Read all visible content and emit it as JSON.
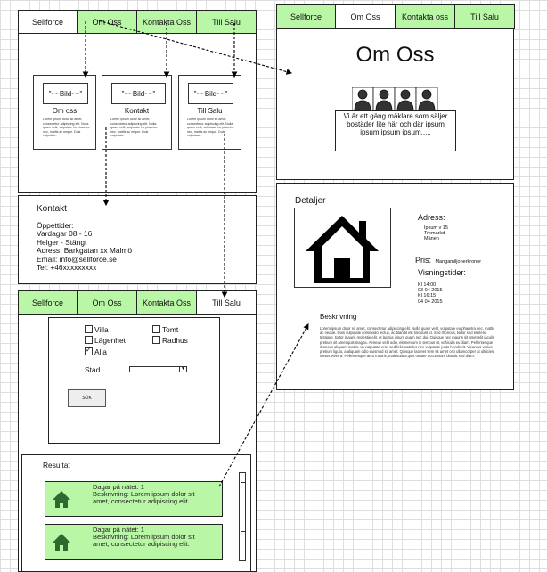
{
  "tabs": [
    "Sellforce",
    "Om Oss",
    "Kontakta Oss",
    "Till Salu"
  ],
  "tabs_lower": [
    "Sellforce",
    "Om Oss",
    "Kontakta Oss",
    "Till Salu"
  ],
  "right_tabs": [
    "Sellforce",
    "Om Oss",
    "Kontakta oss",
    "Till Salu"
  ],
  "home_cards": [
    {
      "image": "\"~~Bild~~\"",
      "title": "Om oss"
    },
    {
      "image": "\"~~Bild~~\"",
      "title": "Kontakt"
    },
    {
      "image": "\"~~Bild~~\"",
      "title": "Till Salu"
    }
  ],
  "card_lorem": "Lorem ipsum dolor sit amet, consectetur adipiscing elit. Nulla quam velit, vulputate eu pharetra nec, mattis ac neque. Duis vulputate.",
  "contact": {
    "heading": "Kontakt",
    "lines": [
      "Öppettider:",
      "Vardagar 08 - 16",
      "Helger - Stängt",
      "Adress: Barkgatan xx Malmö",
      "Email: info@sellforce.se",
      "Tel: +46xxxxxxxxx"
    ]
  },
  "about": {
    "title": "Om Oss",
    "text": "Vi är ett gäng mäklare som säljer bostäder lite här och där ipsum ipsum ipsum ipsum....."
  },
  "details": {
    "heading": "Detaljer",
    "address_label": "Adress:",
    "address_lines": [
      "Ipsum v 15",
      "Tremarkd",
      "Mänen"
    ],
    "price_label": "Pris:",
    "price_value": "Mangamiljonerkronor",
    "viewings_label": "Visningstider:",
    "viewings": [
      "Kl 14:00",
      "03 04 2015",
      "Kl 16:15",
      "04 04 2015"
    ],
    "desc_heading": "Beskrivning",
    "desc_text": "Lorem ipsum dolor sit amet, consectetur adipiscing elit. Nulla quam velit, vulputate eu pharetra nec, mattis ac neque. Duis vulputate commodo lectus, ac blandit elit tincidunt id. Sed rhoncus, tortor sed eleifend tristique, tortor mauris molestie elit, et lacinia ipsum quam nec dui. Quisque nec mauris sit amet elit iaculis pretium sit amet quis magna. Aenean velit odio, elementum in tempus ut, vehicula eu diam. Pellentesque rhoncus aliquam mattis. Ut vulputate eros sed felis sodales nec vulputate justo hendrerit. Vivamus varius pretium ligula, a aliquam odio euismod sit amet. Quisque laoreet sem sit amet orci ullamcorper at ultricies metus viverra. Pellentesque arcu mauris, malesuada quis ornare accumsan, blandit sed diam."
  },
  "search": {
    "checkboxes": [
      {
        "label": "Villa",
        "checked": false
      },
      {
        "label": "Tomt",
        "checked": false
      },
      {
        "label": "Lägenhet",
        "checked": false
      },
      {
        "label": "Radhus",
        "checked": false
      },
      {
        "label": "Alla",
        "checked": true
      }
    ],
    "city_label": "Stad",
    "button": "SÖK"
  },
  "results": {
    "heading": "Resultat",
    "items": [
      {
        "line1": "Dagar på nätet: 1",
        "line2": "Beskrivning: Lorem ipsum dolor sit",
        "line3": "amet, consectetur adipiscing elit."
      },
      {
        "line1": "Dagar på nätet: 1",
        "line2": "Beskrivning: Lorem ipsum dolor sit",
        "line3": "amet, consectetur adipiscing elit."
      }
    ]
  }
}
